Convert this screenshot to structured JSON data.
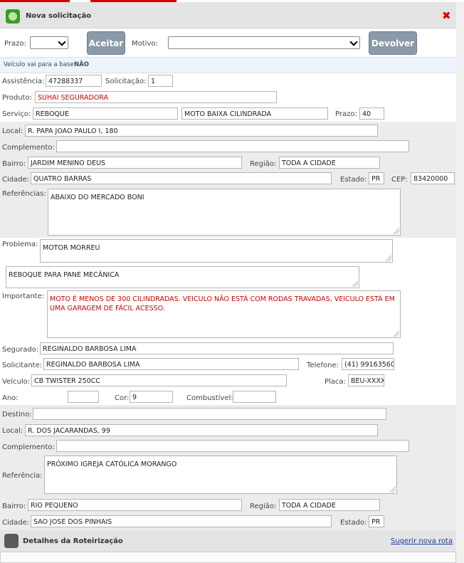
{
  "header": {
    "title": "Nova solicitação"
  },
  "toolbar": {
    "prazo_label": "Prazo:",
    "aceitar_label": "Aceitar",
    "motivo_label": "Motivo:",
    "devolver_label": "Devolver"
  },
  "info": {
    "label": "Veículo vai para a base:",
    "value": "NÃO"
  },
  "fields": {
    "assistencia_label": "Assistência:",
    "assistencia": "47288337",
    "solicitacao_label": "Solicitação:",
    "solicitacao": "1",
    "produto_label": "Produto:",
    "produto": "SUHAI SEGURADORA",
    "servico_label": "Serviço:",
    "servico": "REBOQUE",
    "servico_tipo": "MOTO BAIXA CILINDRADA",
    "prazo_label": "Prazo:",
    "prazo": "40",
    "local_label": "Local:",
    "local": "R. PAPA JOAO PAULO I, 180",
    "complemento_label": "Complemento:",
    "complemento": "",
    "bairro_label": "Bairro:",
    "bairro": "JARDIM MENINO DEUS",
    "regiao_label": "Região:",
    "regiao": "TODA A CIDADE",
    "cidade_label": "Cidade:",
    "cidade": "QUATRO BARRAS",
    "estado_label": "Estado:",
    "estado": "PR",
    "cep_label": "CEP:",
    "cep": "83420000",
    "referencias_label": "Referências:",
    "referencias": "ABAIXO DO MERCADO BONI",
    "problema_label": "Problema:",
    "problema": "MOTOR MORREU",
    "problema_detalhe": "REBOQUE PARA PANE MECÂNICA",
    "importante_label": "Importante:",
    "importante": "MOTO É MENOS DE 300 CILINDRADAS. VEICULO NÃO ESTÁ COM RODAS TRAVADAS, VEICULO ESTÁ EM UMA GARAGEM DE FÁCIL ACESSO.",
    "segurado_label": "Segurado:",
    "segurado": "REGINALDO BARBOSA LIMA",
    "solicitante_label": "Solicitante:",
    "solicitante": "REGINALDO BARBOSA LIMA",
    "telefone_label": "Telefone:",
    "telefone": "(41) 99163560(",
    "veiculo_label": "Veículo:",
    "veiculo": "CB TWISTER 250CC",
    "placa_label": "Placa:",
    "placa": "BEU-XXXX",
    "ano_label": "Ano:",
    "ano": "",
    "cor_label": "Cor:",
    "cor": "9",
    "combustivel_label": "Combustível:",
    "combustivel": ""
  },
  "destino": {
    "destino_label": "Destino:",
    "destino": "",
    "local_label": "Local:",
    "local": "R. DOS JACARANDAS, 99",
    "complemento_label": "Complemento:",
    "complemento": "",
    "referencia_label": "Referência:",
    "referencia": "PRÓXIMO IGREJA CATÓLICA MORANGO",
    "bairro_label": "Bairro:",
    "bairro": "RIO PEQUENO",
    "regiao_label": "Região:",
    "regiao": "TODA A CIDADE",
    "cidade_label": "Cidade:",
    "cidade": "SAO JOSE DOS PINHAIS",
    "estado_label": "Estado:",
    "estado": "PR"
  },
  "footer": {
    "title": "Detalhes da Roteirização",
    "link": "Sugerir nova rota"
  },
  "colors": {
    "accent_red": "#d40000",
    "button": "#8a9aa8",
    "header_bg": "#e4e4e4"
  },
  "icons": {
    "title": "globe-map-icon",
    "close": "close-icon",
    "footer": "globe-map-icon"
  }
}
